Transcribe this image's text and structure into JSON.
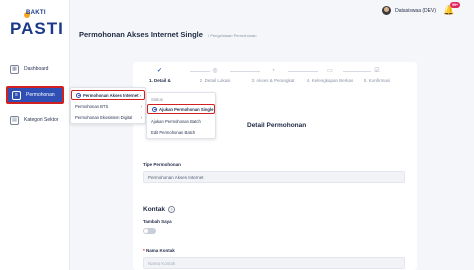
{
  "sidebar": {
    "logo_small": "BAKTI",
    "logo_big": "PASTI",
    "items": [
      {
        "label": "Dashboard",
        "icon": "grid-icon"
      },
      {
        "label": "Permohonan",
        "icon": "form-icon"
      },
      {
        "label": "Kategori Sektor",
        "icon": "document-icon"
      }
    ]
  },
  "header": {
    "user_name": "Datasiswaa (DEV)",
    "notification_badge": "99+"
  },
  "page": {
    "title": "Permohonan Akses Internet Single",
    "breadcrumb": "/ Pengelolaan Permohonan"
  },
  "stepper": {
    "steps": [
      {
        "label": "1. Detail &",
        "icon": "check-icon"
      },
      {
        "label": "2. Detail Lokasi",
        "icon": "pin-icon"
      },
      {
        "label": "3. Akses & Perangkat",
        "icon": "device-icon"
      },
      {
        "label": "4. Kelengkapan Berkas",
        "icon": "folder-icon"
      },
      {
        "label": "5. Konfirmasi",
        "icon": "confirm-icon"
      }
    ]
  },
  "form": {
    "section_title": "Detail Permohonan",
    "tipe_label": "Tipe Permohonan",
    "tipe_value": "Permohonan Akses Internet",
    "kontak_title": "Kontak",
    "tambah_saya_label": "Tambah Saya",
    "nama_kontak_label": "Nama Kontak",
    "nama_kontak_placeholder": "Nama Kontak"
  },
  "menu_primary": {
    "items": [
      {
        "label": "Permohonan Akses Internet"
      },
      {
        "label": "Permohonan BTS"
      },
      {
        "label": "Permohonan Ekosistem Digital"
      }
    ]
  },
  "menu_secondary": {
    "header": "Status",
    "items": [
      {
        "label": "Ajukan Permohonan Single"
      },
      {
        "label": "Ajukan Permohonan Batch"
      },
      {
        "label": "Edit Permohonan Batch"
      }
    ]
  },
  "colors": {
    "primary": "#2f4fb5",
    "highlight": "#d22020",
    "badge": "#e0245e"
  }
}
